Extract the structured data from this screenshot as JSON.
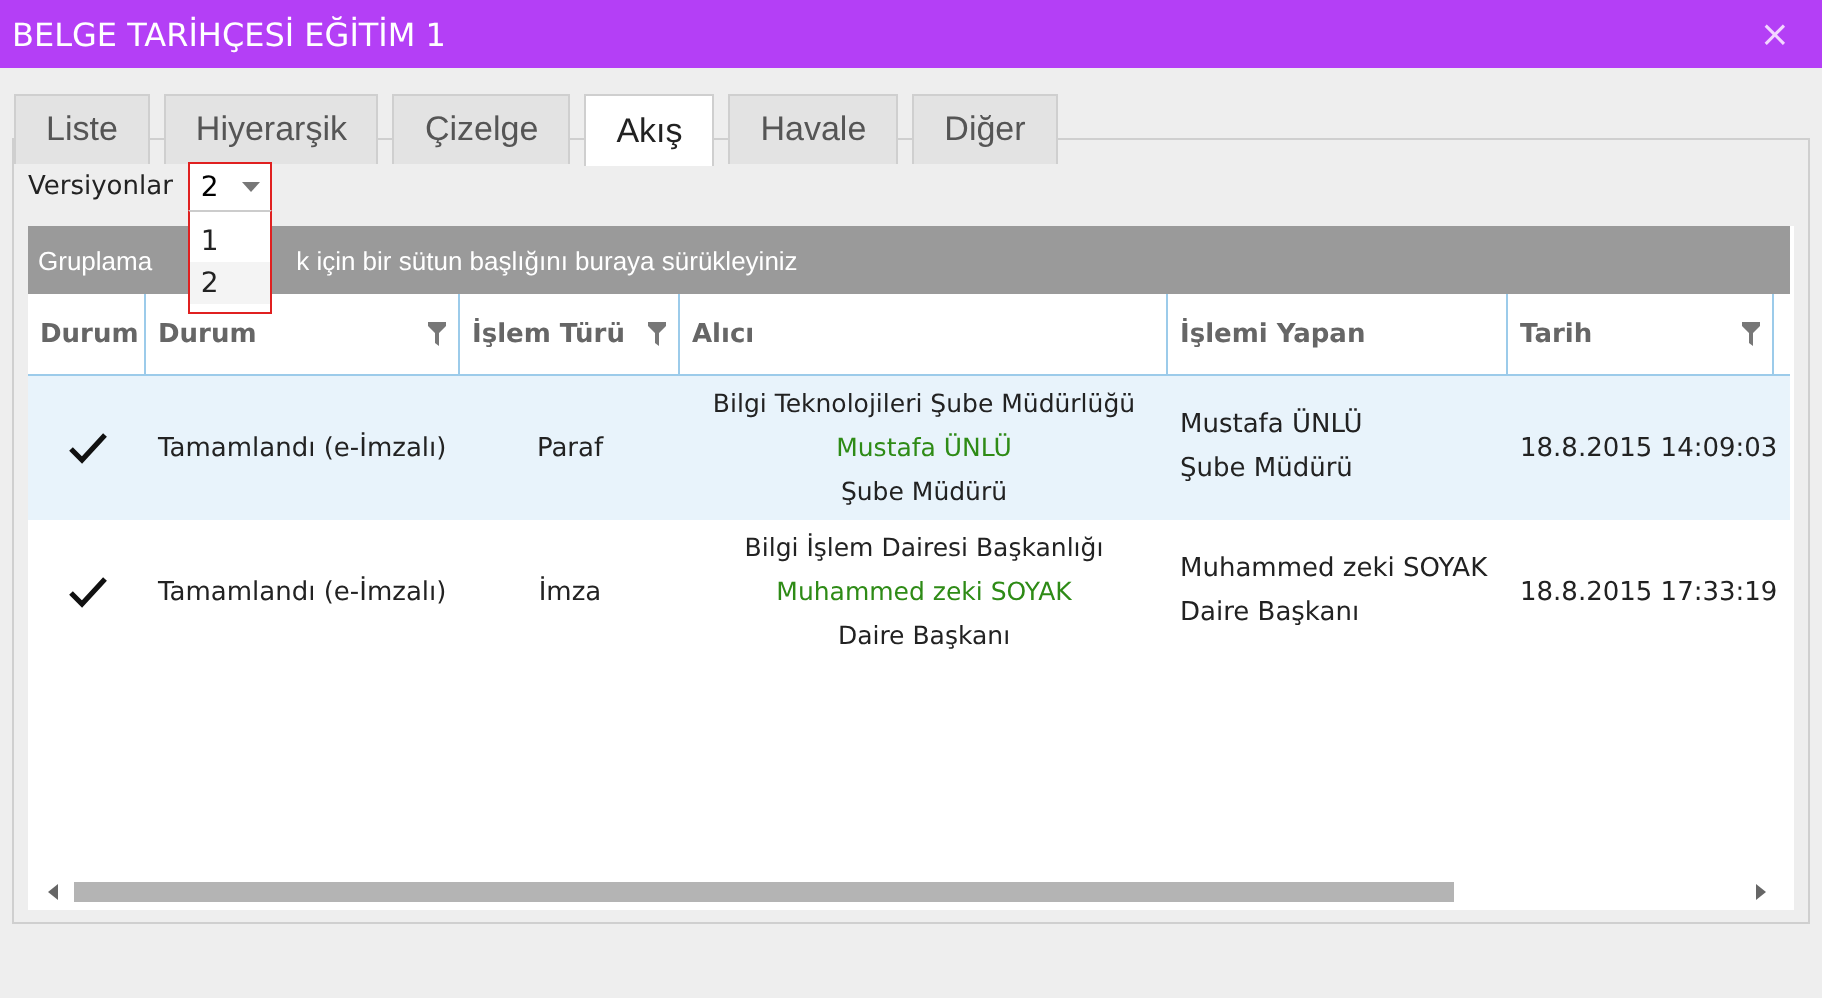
{
  "window": {
    "title": "BELGE TARİHÇESİ EĞİTİM 1",
    "close": "×"
  },
  "tabs": [
    {
      "label": "Liste",
      "selected": false
    },
    {
      "label": "Hiyerarşik",
      "selected": false
    },
    {
      "label": "Çizelge",
      "selected": false
    },
    {
      "label": "Akış",
      "selected": true
    },
    {
      "label": "Havale",
      "selected": false
    },
    {
      "label": "Diğer",
      "selected": false
    }
  ],
  "versions": {
    "label": "Versiyonlar",
    "value": "2",
    "expanded": true,
    "options": [
      {
        "label": "1",
        "selected": false
      },
      {
        "label": "2",
        "selected": true
      }
    ]
  },
  "group_bar": {
    "text_start": "Gruplama",
    "text_end": "k için bir sütun başlığını buraya sürükleyiniz"
  },
  "table": {
    "columns": [
      {
        "label": "Durum",
        "filter": false
      },
      {
        "label": "Durum",
        "filter": true
      },
      {
        "label": "İşlem Türü",
        "filter": true
      },
      {
        "label": "Alıcı",
        "filter": false
      },
      {
        "label": "İşlemi Yapan",
        "filter": false
      },
      {
        "label": "Tarih",
        "filter": true
      }
    ],
    "rows": [
      {
        "selected": true,
        "done": true,
        "status": "Tamamlandı (e-İmzalı)",
        "type": "Paraf",
        "recipient_unit": "Bilgi Teknolojileri Şube Müdürlüğü",
        "recipient_name": "Mustafa ÜNLÜ",
        "recipient_title": "Şube Müdürü",
        "actor_name": "Mustafa ÜNLÜ",
        "actor_title": "Şube Müdürü",
        "date": "18.8.2015 14:09:03"
      },
      {
        "selected": false,
        "done": true,
        "status": "Tamamlandı (e-İmzalı)",
        "type": "İmza",
        "recipient_unit": "Bilgi İşlem Dairesi Başkanlığı",
        "recipient_name": "Muhammed zeki SOYAK",
        "recipient_title": "Daire Başkanı",
        "actor_name": "Muhammed zeki SOYAK",
        "actor_title": "Daire Başkanı",
        "date": "18.8.2015 17:33:19"
      }
    ]
  }
}
